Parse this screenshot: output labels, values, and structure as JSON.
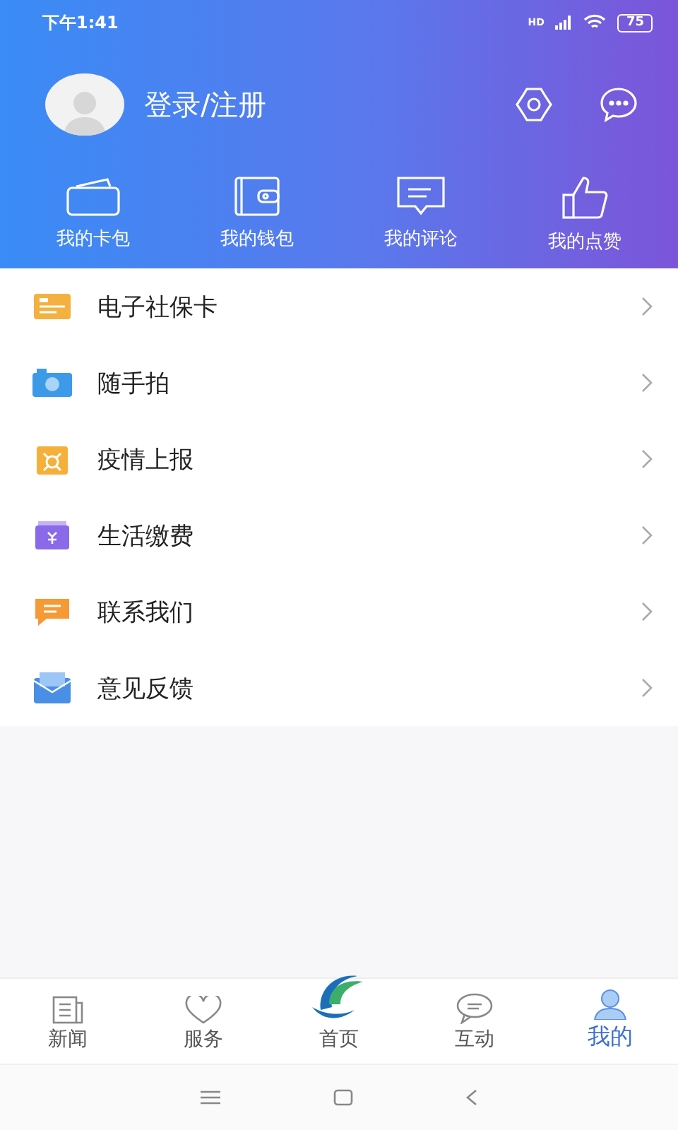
{
  "status_bar": {
    "time": "下午1:41",
    "network": "HD",
    "battery": "75"
  },
  "profile": {
    "login": "登录/注册"
  },
  "shortcuts": [
    {
      "label": "我的卡包"
    },
    {
      "label": "我的钱包"
    },
    {
      "label": "我的评论"
    },
    {
      "label": "我的点赞"
    }
  ],
  "menu": [
    {
      "label": "电子社保卡"
    },
    {
      "label": "随手拍"
    },
    {
      "label": "疫情上报"
    },
    {
      "label": "生活缴费"
    },
    {
      "label": "联系我们"
    },
    {
      "label": "意见反馈"
    }
  ],
  "tabs": [
    {
      "label": "新闻",
      "selected": false
    },
    {
      "label": "服务",
      "selected": false
    },
    {
      "label": "首页",
      "selected": false
    },
    {
      "label": "互动",
      "selected": false
    },
    {
      "label": "我的",
      "selected": true
    }
  ]
}
